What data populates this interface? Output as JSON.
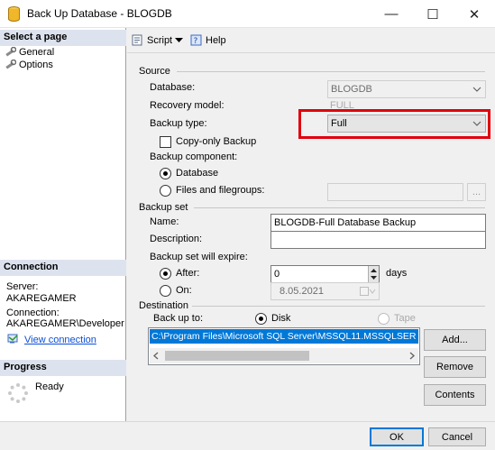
{
  "window": {
    "title": "Back Up Database - BLOGDB",
    "minimize": "—",
    "maximize": "☐",
    "close": "✕"
  },
  "left_pane": {
    "select_page_header": "Select a page",
    "pages": [
      "General",
      "Options"
    ],
    "connection_header": "Connection",
    "server_label": "Server:",
    "server_value": "AKAREGAMER",
    "connection_label": "Connection:",
    "connection_value": "AKAREGAMER\\Developer",
    "view_connection": "View connection",
    "progress_header": "Progress",
    "progress_status": "Ready"
  },
  "toolbar": {
    "script_label": "Script",
    "help_label": "Help"
  },
  "source": {
    "section_title": "Source",
    "database_label": "Database:",
    "database_value": "BLOGDB",
    "recovery_model_label": "Recovery model:",
    "recovery_model_value": "FULL",
    "backup_type_label": "Backup type:",
    "backup_type_value": "Full",
    "copy_only_label": "Copy-only Backup",
    "backup_component_label": "Backup component:",
    "component_database": "Database",
    "component_files": "Files and filegroups:"
  },
  "backup_set": {
    "section_title": "Backup set",
    "name_label": "Name:",
    "name_value": "BLOGDB-Full Database Backup",
    "description_label": "Description:",
    "description_value": "",
    "expire_label": "Backup set will expire:",
    "after_label": "After:",
    "after_value": "0",
    "days_label": "days",
    "on_label": "On:",
    "on_value": "8.05.2021"
  },
  "destination": {
    "section_title": "Destination",
    "back_up_to_label": "Back up to:",
    "disk_label": "Disk",
    "tape_label": "Tape",
    "path": "C:\\Program Files\\Microsoft SQL Server\\MSSQL11.MSSQLSER",
    "add_button": "Add...",
    "remove_button": "Remove",
    "contents_button": "Contents"
  },
  "footer": {
    "ok_button": "OK",
    "cancel_button": "Cancel"
  },
  "colors": {
    "highlight": "#e0000e",
    "selection": "#0078d7",
    "pane_header": "#dde3ee"
  }
}
